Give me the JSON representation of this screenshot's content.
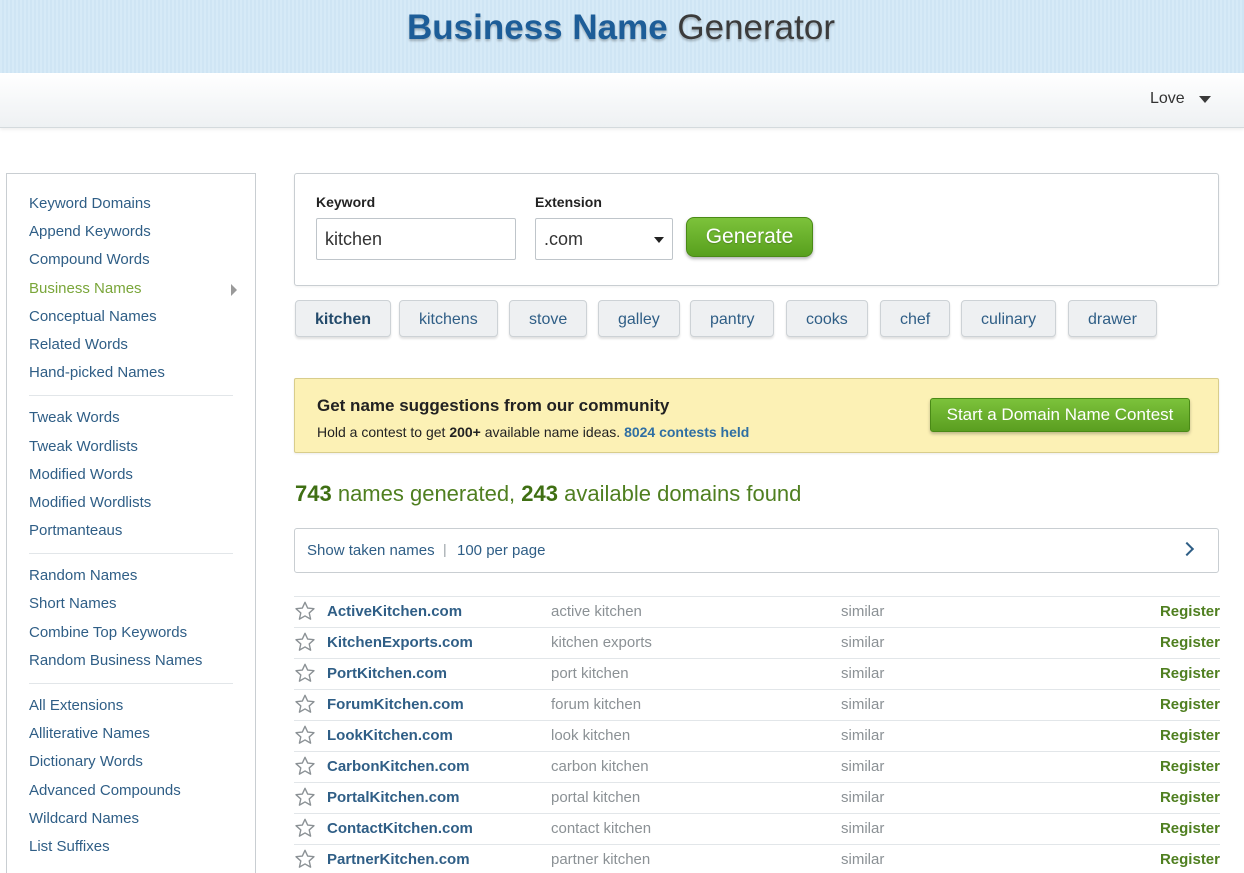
{
  "header": {
    "title_bold": "Business Name",
    "title_light": " Generator"
  },
  "nav": {
    "love_label": "Love"
  },
  "sidebar": {
    "groups": [
      [
        "Keyword Domains",
        "Append Keywords",
        "Compound Words",
        "Business Names",
        "Conceptual Names",
        "Related Words",
        "Hand-picked Names"
      ],
      [
        "Tweak Words",
        "Tweak Wordlists",
        "Modified Words",
        "Modified Wordlists",
        "Portmanteaus"
      ],
      [
        "Random Names",
        "Short Names",
        "Combine Top Keywords",
        "Random Business Names"
      ],
      [
        "All Extensions",
        "Alliterative Names",
        "Dictionary Words",
        "Advanced Compounds",
        "Wildcard Names",
        "List Suffixes"
      ]
    ],
    "active_item": "Business Names"
  },
  "form": {
    "keyword_label": "Keyword",
    "keyword_value": "kitchen",
    "extension_label": "Extension",
    "extension_value": ".com",
    "generate_label": "Generate"
  },
  "chips": [
    "kitchen",
    "kitchens",
    "stove",
    "galley",
    "pantry",
    "cooks",
    "chef",
    "culinary",
    "drawer"
  ],
  "contest": {
    "heading": "Get name suggestions from our community",
    "text_before": "Hold a contest to get ",
    "text_bold": "200+",
    "text_after": " available name ideas. ",
    "held_link": "8024 contests held",
    "button_label": "Start a Domain Name Contest"
  },
  "summary": {
    "names_count": "743",
    "names_text": " names generated, ",
    "domains_count": "243",
    "domains_text": " available domains found"
  },
  "filter": {
    "show_taken": "Show taken names",
    "separator": "|",
    "per_page": "100 per page"
  },
  "results": [
    {
      "domain": "ActiveKitchen.com",
      "words": "active kitchen",
      "similar": "similar",
      "action": "Register"
    },
    {
      "domain": "KitchenExports.com",
      "words": "kitchen exports",
      "similar": "similar",
      "action": "Register"
    },
    {
      "domain": "PortKitchen.com",
      "words": "port kitchen",
      "similar": "similar",
      "action": "Register"
    },
    {
      "domain": "ForumKitchen.com",
      "words": "forum kitchen",
      "similar": "similar",
      "action": "Register"
    },
    {
      "domain": "LookKitchen.com",
      "words": "look kitchen",
      "similar": "similar",
      "action": "Register"
    },
    {
      "domain": "CarbonKitchen.com",
      "words": "carbon kitchen",
      "similar": "similar",
      "action": "Register"
    },
    {
      "domain": "PortalKitchen.com",
      "words": "portal kitchen",
      "similar": "similar",
      "action": "Register"
    },
    {
      "domain": "ContactKitchen.com",
      "words": "contact kitchen",
      "similar": "similar",
      "action": "Register"
    },
    {
      "domain": "PartnerKitchen.com",
      "words": "partner kitchen",
      "similar": "similar",
      "action": "Register"
    }
  ],
  "colors": {
    "brand_blue": "#1d5d98",
    "link_blue": "#2f5e86",
    "accent_green": "#58a01d",
    "contest_bg": "#fcf1b5"
  }
}
